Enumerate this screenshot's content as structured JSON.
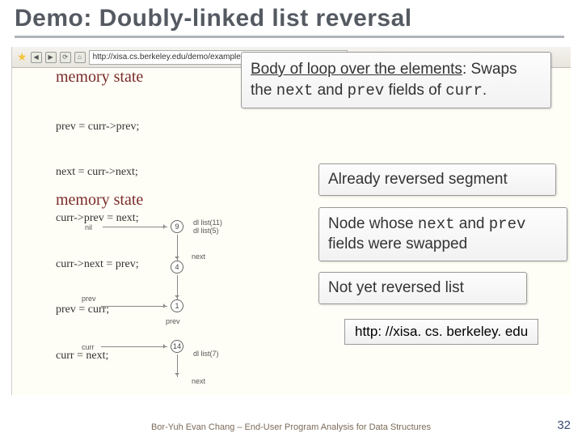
{
  "title": "Demo: Doubly-linked list reversal",
  "url": "http://xisa.cs.berkeley.edu/demo/examples/dll.reverse.inv/dll.reverse.html",
  "memstate_label": "memory state",
  "code": {
    "l1": "prev = curr->prev;",
    "l2": "next = curr->next;",
    "l3": "curr->prev = next;",
    "l4": "curr->next = prev;",
    "l5": "prev = curr;",
    "l6": "curr = next;"
  },
  "callouts": {
    "body_u": "Body of loop over the elements",
    "body_rest_1": ": Swaps the ",
    "body_next": "next",
    "body_rest_2": " and ",
    "body_prev": "prev",
    "body_rest_3": " fields of ",
    "body_curr": "curr",
    "body_rest_4": ".",
    "reversed": "Already reversed segment",
    "swapped_1": "Node whose ",
    "swapped_next": "next",
    "swapped_2": " and ",
    "swapped_prev": "prev",
    "swapped_3": " fields were swapped",
    "notyet": "Not yet reversed list"
  },
  "urlbox": "http: //xisa. cs. berkeley. edu",
  "diagram": {
    "nil": "nil",
    "prev": "prev",
    "curr": "curr",
    "next": "next",
    "n9": "9",
    "n4": "4",
    "n1": "1",
    "n14": "14",
    "dlist11": "dl list(11)",
    "dlist5": "dl list(5)",
    "dlist7": "dl list(7)"
  },
  "footer": "Bor-Yuh Evan Chang – End-User Program Analysis for Data Structures",
  "page": "32"
}
